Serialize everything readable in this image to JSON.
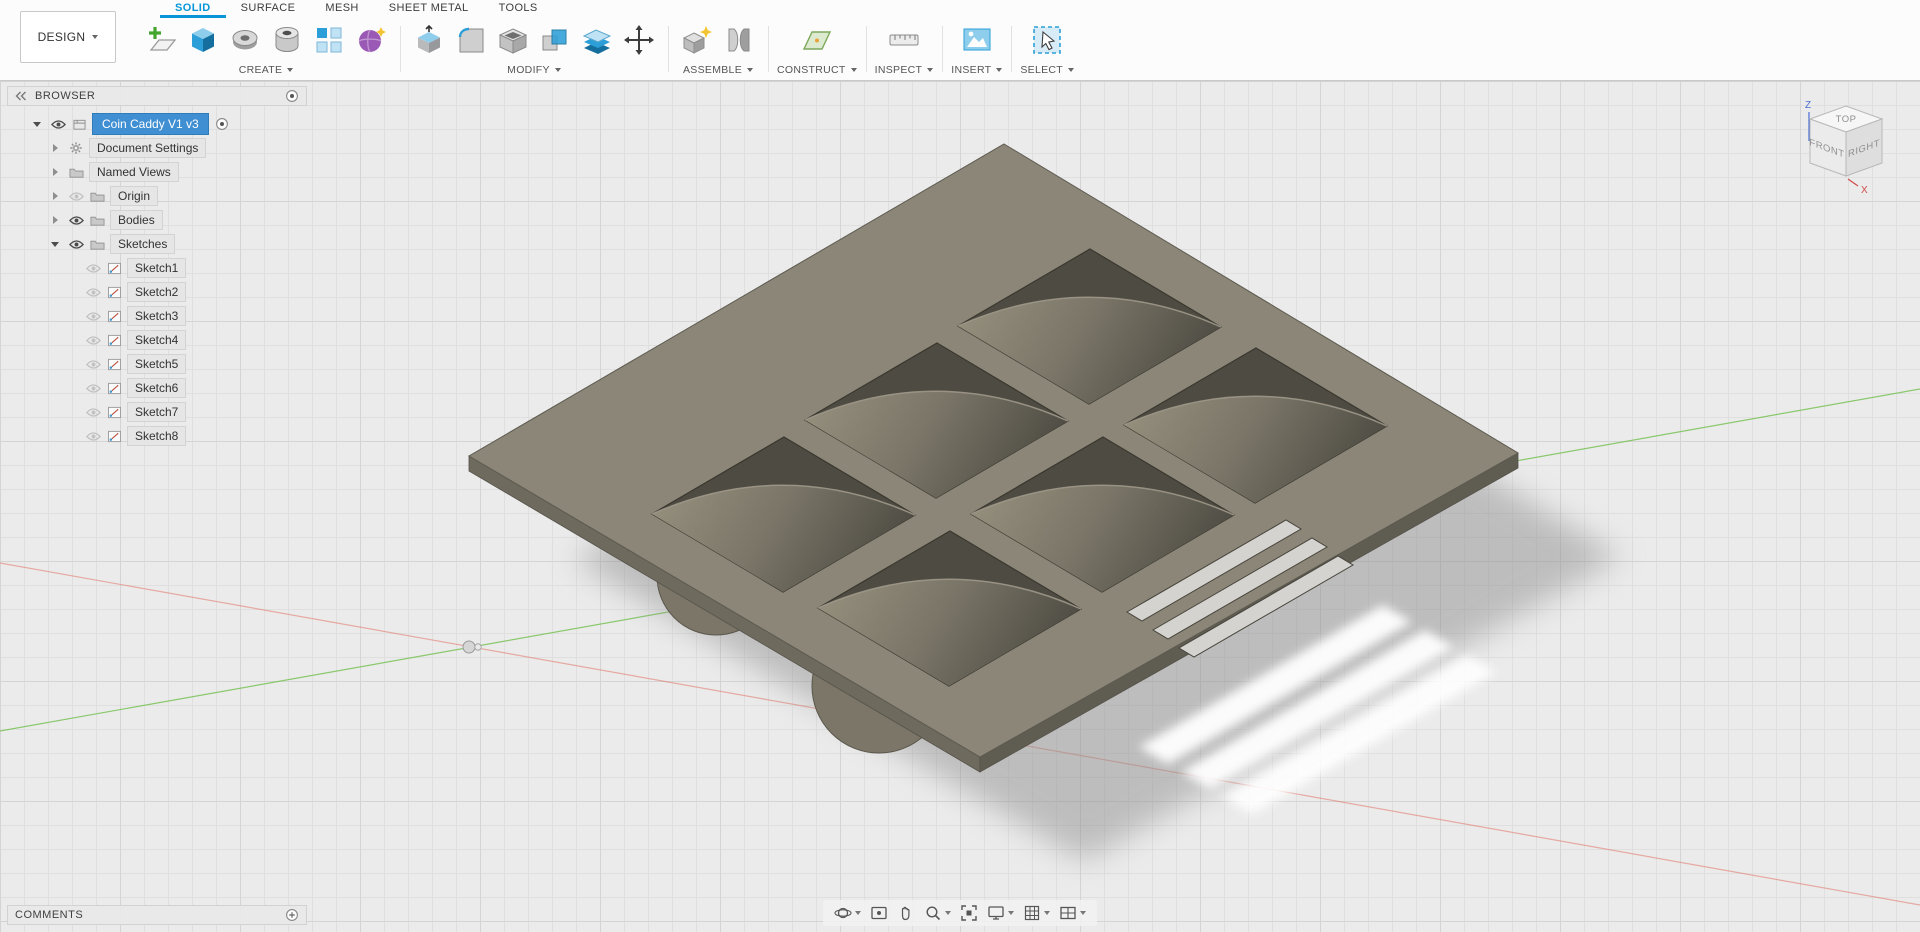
{
  "colors": {
    "accent": "#0696d7",
    "selection_blue": "#3f8fd2",
    "canvas_bg": "#ebebeb",
    "model_top": "#8c8678",
    "model_side": "#6e6a5e",
    "axis_green": "#79c257",
    "axis_red": "#e06a5a"
  },
  "topbar": {
    "workspace_selector": {
      "label": "DESIGN"
    },
    "tabs": [
      {
        "label": "SOLID",
        "active": true
      },
      {
        "label": "SURFACE",
        "active": false
      },
      {
        "label": "MESH",
        "active": false
      },
      {
        "label": "SHEET METAL",
        "active": false
      },
      {
        "label": "TOOLS",
        "active": false
      }
    ],
    "groups": [
      {
        "label": "CREATE"
      },
      {
        "label": "MODIFY"
      },
      {
        "label": "ASSEMBLE"
      },
      {
        "label": "CONSTRUCT"
      },
      {
        "label": "INSPECT"
      },
      {
        "label": "INSERT"
      },
      {
        "label": "SELECT"
      }
    ]
  },
  "browser": {
    "title": "BROWSER",
    "root": {
      "label": "Coin Caddy V1 v3"
    },
    "items": [
      {
        "label": "Document Settings"
      },
      {
        "label": "Named Views"
      },
      {
        "label": "Origin"
      },
      {
        "label": "Bodies"
      },
      {
        "label": "Sketches"
      }
    ],
    "sketches": [
      {
        "label": "Sketch1"
      },
      {
        "label": "Sketch2"
      },
      {
        "label": "Sketch3"
      },
      {
        "label": "Sketch4"
      },
      {
        "label": "Sketch5"
      },
      {
        "label": "Sketch6"
      },
      {
        "label": "Sketch7"
      },
      {
        "label": "Sketch8"
      }
    ]
  },
  "viewcube": {
    "top": "TOP",
    "front": "FRONT",
    "right": "RIGHT",
    "axis_z": "Z",
    "axis_x": "X"
  },
  "comments": {
    "title": "COMMENTS"
  }
}
